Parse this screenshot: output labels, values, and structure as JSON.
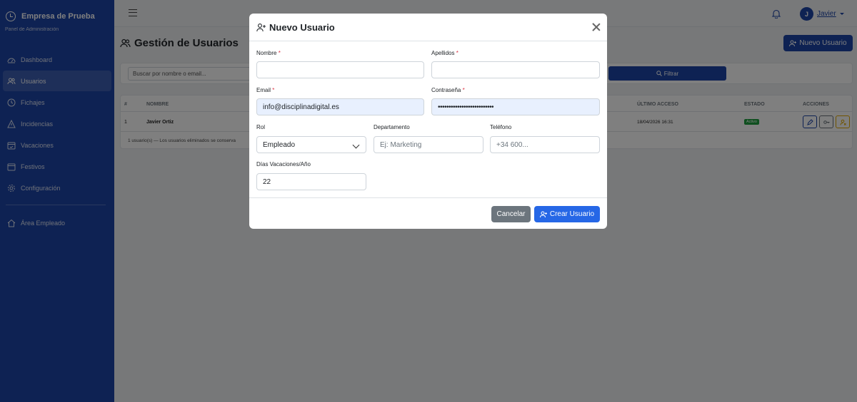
{
  "sidebar": {
    "brand": "Empresa de Prueba",
    "subtitle": "Panel de Administración",
    "items": [
      {
        "label": "Dashboard",
        "icon": "dashboard-icon"
      },
      {
        "label": "Usuarios",
        "icon": "users-icon",
        "active": true
      },
      {
        "label": "Fichajes",
        "icon": "clock-icon"
      },
      {
        "label": "Incidencias",
        "icon": "warning-icon"
      },
      {
        "label": "Vacaciones",
        "icon": "calendar-check-icon"
      },
      {
        "label": "Festivos",
        "icon": "calendar-icon"
      },
      {
        "label": "Configuración",
        "icon": "gear-icon"
      }
    ],
    "employee_area": "Área Empleado"
  },
  "topbar": {
    "user_initial": "J",
    "user_name": "Javier"
  },
  "main": {
    "title": "Gestión de Usuarios",
    "new_user_label": "Nuevo Usuario",
    "search_placeholder": "Buscar por nombre o email...",
    "filter_label": "Filtrar",
    "table": {
      "headers": {
        "num": "#",
        "name": "NOMBRE",
        "last_access": "ÚLTIMO ACCESO",
        "status": "ESTADO",
        "actions": "ACCIONES"
      },
      "row": {
        "num": "1",
        "name": "Javier Ortiz",
        "last_access": "18/04/2026 16:31",
        "status": "Activo"
      },
      "footer": "1 usuario(s) — Los usuarios eliminados se conserva"
    }
  },
  "modal": {
    "title": "Nuevo Usuario",
    "fields": {
      "nombre": {
        "label": "Nombre",
        "value": ""
      },
      "apellidos": {
        "label": "Apellidos",
        "value": ""
      },
      "email": {
        "label": "Email",
        "value": "info@disciplinadigital.es"
      },
      "password": {
        "label": "Contraseña",
        "value": "••••••••••••••••••••••••••"
      },
      "rol": {
        "label": "Rol",
        "value": "Empleado"
      },
      "departamento": {
        "label": "Departamento",
        "placeholder": "Ej: Marketing"
      },
      "telefono": {
        "label": "Teléfono",
        "placeholder": "+34 600..."
      },
      "dias": {
        "label": "Días Vacaciones/Año",
        "value": "22"
      }
    },
    "required_mark": "*",
    "cancel_label": "Cancelar",
    "create_label": "Crear Usuario"
  },
  "colors": {
    "primary": "#1c44a6",
    "create": "#2667e6",
    "cancel": "#6c757d",
    "required": "#dc3545"
  }
}
